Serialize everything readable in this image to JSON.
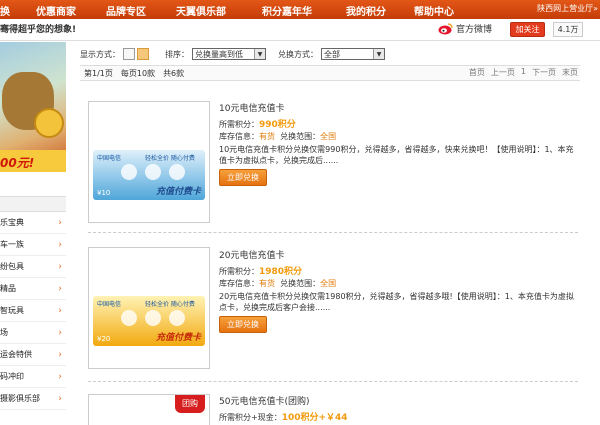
{
  "nav": {
    "items": [
      "换",
      "优惠商家",
      "品牌专区",
      "天翼俱乐部",
      "积分嘉年华",
      "我的积分",
      "帮助中心"
    ],
    "region": "陕西网上营业厅»"
  },
  "slogan": "骞得超乎您的想象!",
  "weibo": {
    "label": "官方微博",
    "follow": "加关注",
    "count": "4.1万"
  },
  "banner": {
    "text": "00元!"
  },
  "sidebar": {
    "items": [
      "乐宝典",
      "车一族",
      "纷包具",
      "精品",
      "智玩具",
      "场",
      "运会特供",
      "码冲印",
      "摄影俱乐部"
    ]
  },
  "toolbar": {
    "view_label": "显示方式：",
    "sort_label": "排序：",
    "sort_value": "兑换量高到低",
    "method_label": "兑换方式：",
    "method_value": "全部"
  },
  "pager": {
    "page": "第1/1页",
    "per_page": "每页10款",
    "total": "共6款",
    "links": [
      "首页",
      "上一页",
      "1",
      "下一页",
      "末页"
    ]
  },
  "products": [
    {
      "name": "10元电信充值卡",
      "points_label": "所需积分：",
      "points": "990积分",
      "stock_label": "库存信息：",
      "stock": "有货",
      "range_label": "兑换范围：",
      "range": "全国",
      "desc": "10元电信充值卡积分兑换仅需990积分，兑得越多，省得越多，快来兑换吧！【使用说明】：1、本充值卡为虚拟点卡，兑换完成后......",
      "button": "立即兑换",
      "card_brand": "中国电信",
      "card_tag": "轻松全价 随心付费",
      "card_title": "充值付费卡",
      "card_value": "¥10"
    },
    {
      "name": "20元电信充值卡",
      "points_label": "所需积分：",
      "points": "1980积分",
      "stock_label": "库存信息：",
      "stock": "有货",
      "range_label": "兑换范围：",
      "range": "全国",
      "desc": "20元电信充值卡积分兑换仅需1980积分，兑得越多，省得越多哦!【使用说明】：1、本充值卡为虚拟点卡，兑换完成后客户会接......",
      "button": "立即兑换",
      "card_brand": "中国电信",
      "card_tag": "轻松全价 随心付费",
      "card_title": "充值付费卡",
      "card_value": "¥20"
    },
    {
      "name": "50元电信充值卡(团购)",
      "points_label": "所需积分+现金：",
      "points": "100积分+￥44",
      "badge": "团购"
    }
  ],
  "colors": {
    "nav": "#d8480e",
    "accent": "#f29a0b",
    "button": "#e47310"
  }
}
